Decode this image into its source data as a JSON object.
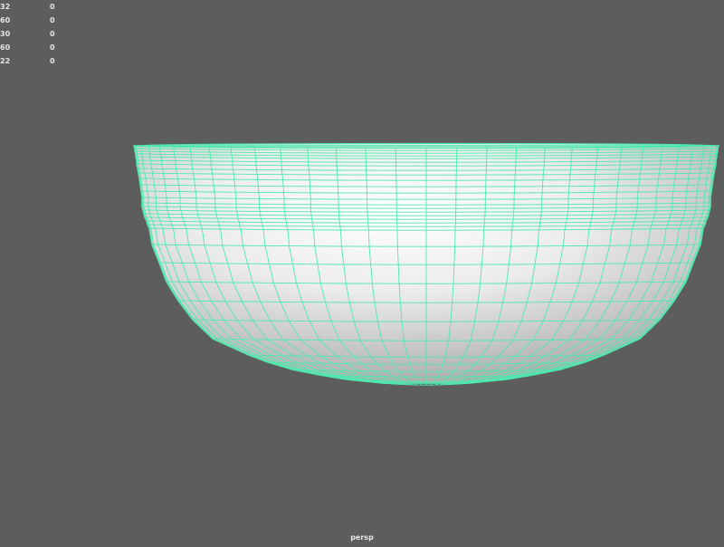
{
  "hud": {
    "rows": [
      {
        "count": "32",
        "selected": "0"
      },
      {
        "count": "60",
        "selected": "0"
      },
      {
        "count": "30",
        "selected": "0"
      },
      {
        "count": "60",
        "selected": "0"
      },
      {
        "count": "22",
        "selected": "0"
      }
    ]
  },
  "viewport": {
    "camera": "persp",
    "background_color": "#5d5d5d",
    "wire_color": "#4fe8ad",
    "mesh_type": "bowl"
  }
}
